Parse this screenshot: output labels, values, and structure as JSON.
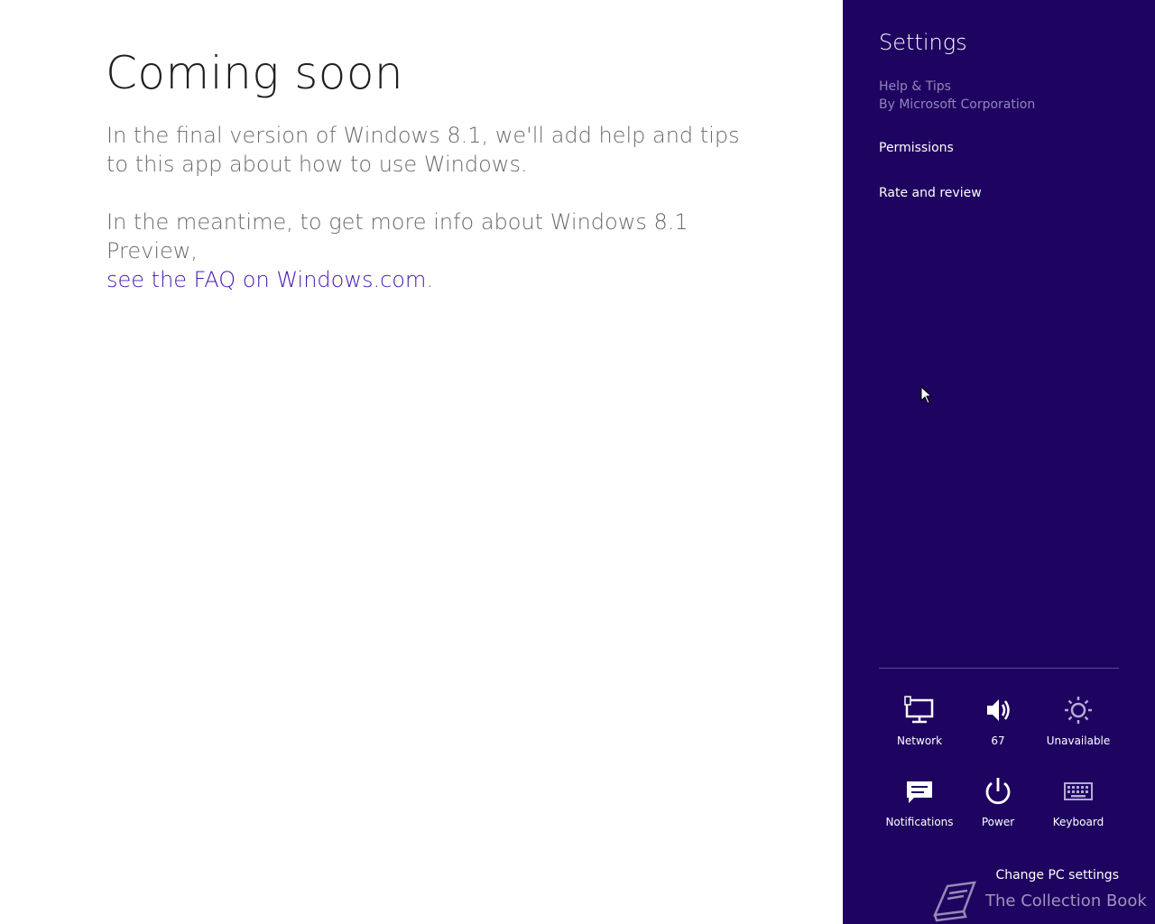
{
  "main": {
    "title": "Coming soon",
    "paragraph1": "In the final version of Windows 8.1, we'll add help and tips to this app about how to use Windows.",
    "paragraph2_prefix": "In the meantime, to get more info about Windows 8.1 Preview,",
    "faq_link": "see the FAQ on Windows.com",
    "paragraph2_suffix": "."
  },
  "charm": {
    "title": "Settings",
    "app_name": "Help & Tips",
    "publisher": "By Microsoft Corporation",
    "links": {
      "permissions": "Permissions",
      "rate": "Rate and review"
    },
    "quick_settings": {
      "network": {
        "label": "Network",
        "icon": "network-icon"
      },
      "volume": {
        "label": "67",
        "icon": "volume-icon"
      },
      "brightness": {
        "label": "Unavailable",
        "icon": "brightness-icon"
      },
      "notifications": {
        "label": "Notifications",
        "icon": "notifications-icon"
      },
      "power": {
        "label": "Power",
        "icon": "power-icon"
      },
      "keyboard": {
        "label": "Keyboard",
        "icon": "keyboard-icon"
      }
    },
    "change_pc_settings": "Change PC settings"
  },
  "watermark": {
    "text": "The Collection Book"
  },
  "colors": {
    "charm_bg": "#1e0361",
    "link": "#4617b4",
    "muted_text": "#9186b8"
  }
}
